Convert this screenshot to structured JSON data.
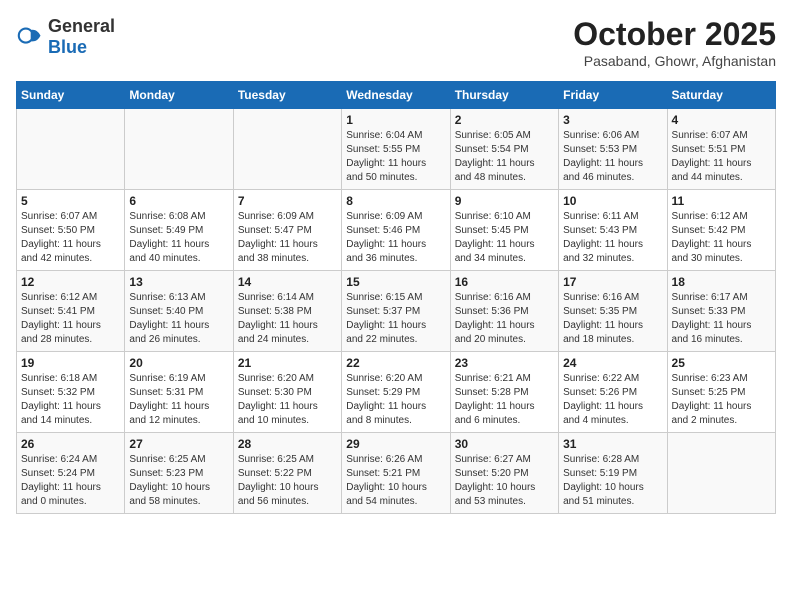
{
  "header": {
    "logo": {
      "general": "General",
      "blue": "Blue"
    },
    "title": "October 2025",
    "location": "Pasaband, Ghowr, Afghanistan"
  },
  "days_of_week": [
    "Sunday",
    "Monday",
    "Tuesday",
    "Wednesday",
    "Thursday",
    "Friday",
    "Saturday"
  ],
  "weeks": [
    [
      {
        "day": "",
        "info": ""
      },
      {
        "day": "",
        "info": ""
      },
      {
        "day": "",
        "info": ""
      },
      {
        "day": "1",
        "info": "Sunrise: 6:04 AM\nSunset: 5:55 PM\nDaylight: 11 hours\nand 50 minutes."
      },
      {
        "day": "2",
        "info": "Sunrise: 6:05 AM\nSunset: 5:54 PM\nDaylight: 11 hours\nand 48 minutes."
      },
      {
        "day": "3",
        "info": "Sunrise: 6:06 AM\nSunset: 5:53 PM\nDaylight: 11 hours\nand 46 minutes."
      },
      {
        "day": "4",
        "info": "Sunrise: 6:07 AM\nSunset: 5:51 PM\nDaylight: 11 hours\nand 44 minutes."
      }
    ],
    [
      {
        "day": "5",
        "info": "Sunrise: 6:07 AM\nSunset: 5:50 PM\nDaylight: 11 hours\nand 42 minutes."
      },
      {
        "day": "6",
        "info": "Sunrise: 6:08 AM\nSunset: 5:49 PM\nDaylight: 11 hours\nand 40 minutes."
      },
      {
        "day": "7",
        "info": "Sunrise: 6:09 AM\nSunset: 5:47 PM\nDaylight: 11 hours\nand 38 minutes."
      },
      {
        "day": "8",
        "info": "Sunrise: 6:09 AM\nSunset: 5:46 PM\nDaylight: 11 hours\nand 36 minutes."
      },
      {
        "day": "9",
        "info": "Sunrise: 6:10 AM\nSunset: 5:45 PM\nDaylight: 11 hours\nand 34 minutes."
      },
      {
        "day": "10",
        "info": "Sunrise: 6:11 AM\nSunset: 5:43 PM\nDaylight: 11 hours\nand 32 minutes."
      },
      {
        "day": "11",
        "info": "Sunrise: 6:12 AM\nSunset: 5:42 PM\nDaylight: 11 hours\nand 30 minutes."
      }
    ],
    [
      {
        "day": "12",
        "info": "Sunrise: 6:12 AM\nSunset: 5:41 PM\nDaylight: 11 hours\nand 28 minutes."
      },
      {
        "day": "13",
        "info": "Sunrise: 6:13 AM\nSunset: 5:40 PM\nDaylight: 11 hours\nand 26 minutes."
      },
      {
        "day": "14",
        "info": "Sunrise: 6:14 AM\nSunset: 5:38 PM\nDaylight: 11 hours\nand 24 minutes."
      },
      {
        "day": "15",
        "info": "Sunrise: 6:15 AM\nSunset: 5:37 PM\nDaylight: 11 hours\nand 22 minutes."
      },
      {
        "day": "16",
        "info": "Sunrise: 6:16 AM\nSunset: 5:36 PM\nDaylight: 11 hours\nand 20 minutes."
      },
      {
        "day": "17",
        "info": "Sunrise: 6:16 AM\nSunset: 5:35 PM\nDaylight: 11 hours\nand 18 minutes."
      },
      {
        "day": "18",
        "info": "Sunrise: 6:17 AM\nSunset: 5:33 PM\nDaylight: 11 hours\nand 16 minutes."
      }
    ],
    [
      {
        "day": "19",
        "info": "Sunrise: 6:18 AM\nSunset: 5:32 PM\nDaylight: 11 hours\nand 14 minutes."
      },
      {
        "day": "20",
        "info": "Sunrise: 6:19 AM\nSunset: 5:31 PM\nDaylight: 11 hours\nand 12 minutes."
      },
      {
        "day": "21",
        "info": "Sunrise: 6:20 AM\nSunset: 5:30 PM\nDaylight: 11 hours\nand 10 minutes."
      },
      {
        "day": "22",
        "info": "Sunrise: 6:20 AM\nSunset: 5:29 PM\nDaylight: 11 hours\nand 8 minutes."
      },
      {
        "day": "23",
        "info": "Sunrise: 6:21 AM\nSunset: 5:28 PM\nDaylight: 11 hours\nand 6 minutes."
      },
      {
        "day": "24",
        "info": "Sunrise: 6:22 AM\nSunset: 5:26 PM\nDaylight: 11 hours\nand 4 minutes."
      },
      {
        "day": "25",
        "info": "Sunrise: 6:23 AM\nSunset: 5:25 PM\nDaylight: 11 hours\nand 2 minutes."
      }
    ],
    [
      {
        "day": "26",
        "info": "Sunrise: 6:24 AM\nSunset: 5:24 PM\nDaylight: 11 hours\nand 0 minutes."
      },
      {
        "day": "27",
        "info": "Sunrise: 6:25 AM\nSunset: 5:23 PM\nDaylight: 10 hours\nand 58 minutes."
      },
      {
        "day": "28",
        "info": "Sunrise: 6:25 AM\nSunset: 5:22 PM\nDaylight: 10 hours\nand 56 minutes."
      },
      {
        "day": "29",
        "info": "Sunrise: 6:26 AM\nSunset: 5:21 PM\nDaylight: 10 hours\nand 54 minutes."
      },
      {
        "day": "30",
        "info": "Sunrise: 6:27 AM\nSunset: 5:20 PM\nDaylight: 10 hours\nand 53 minutes."
      },
      {
        "day": "31",
        "info": "Sunrise: 6:28 AM\nSunset: 5:19 PM\nDaylight: 10 hours\nand 51 minutes."
      },
      {
        "day": "",
        "info": ""
      }
    ]
  ]
}
